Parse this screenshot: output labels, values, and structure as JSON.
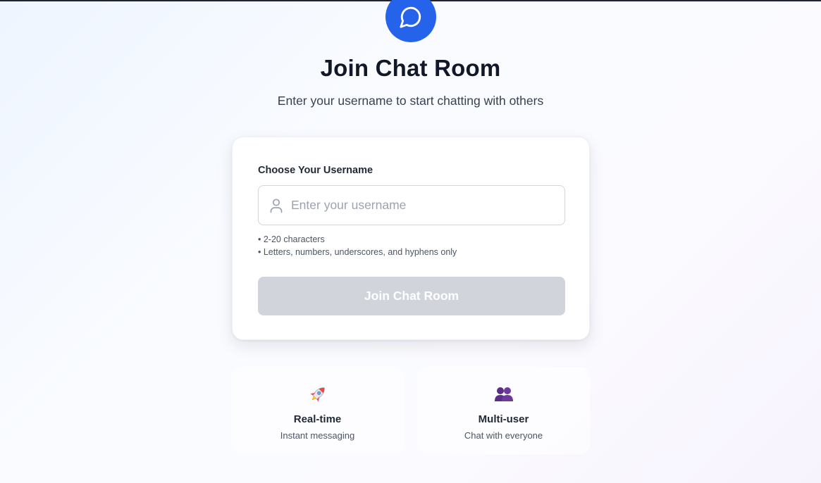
{
  "header": {
    "logo_icon": "chat-bubble-icon",
    "title": "Join Chat Room",
    "subtitle": "Enter your username to start chatting with others"
  },
  "form": {
    "label": "Choose Your Username",
    "input": {
      "placeholder": "Enter your username",
      "value": "",
      "icon": "user-icon"
    },
    "hints": [
      "• 2-20 characters",
      "• Letters, numbers, underscores, and hyphens only"
    ],
    "submit_label": "Join Chat Room",
    "submit_disabled": true
  },
  "features": [
    {
      "icon": "rocket-icon",
      "title": "Real-time",
      "description": "Instant messaging"
    },
    {
      "icon": "users-icon",
      "title": "Multi-user",
      "description": "Chat with everyone"
    }
  ],
  "colors": {
    "accent": "#2563eb",
    "button_disabled": "#d1d5db",
    "text_primary": "#111827",
    "text_secondary": "#4b5563"
  }
}
